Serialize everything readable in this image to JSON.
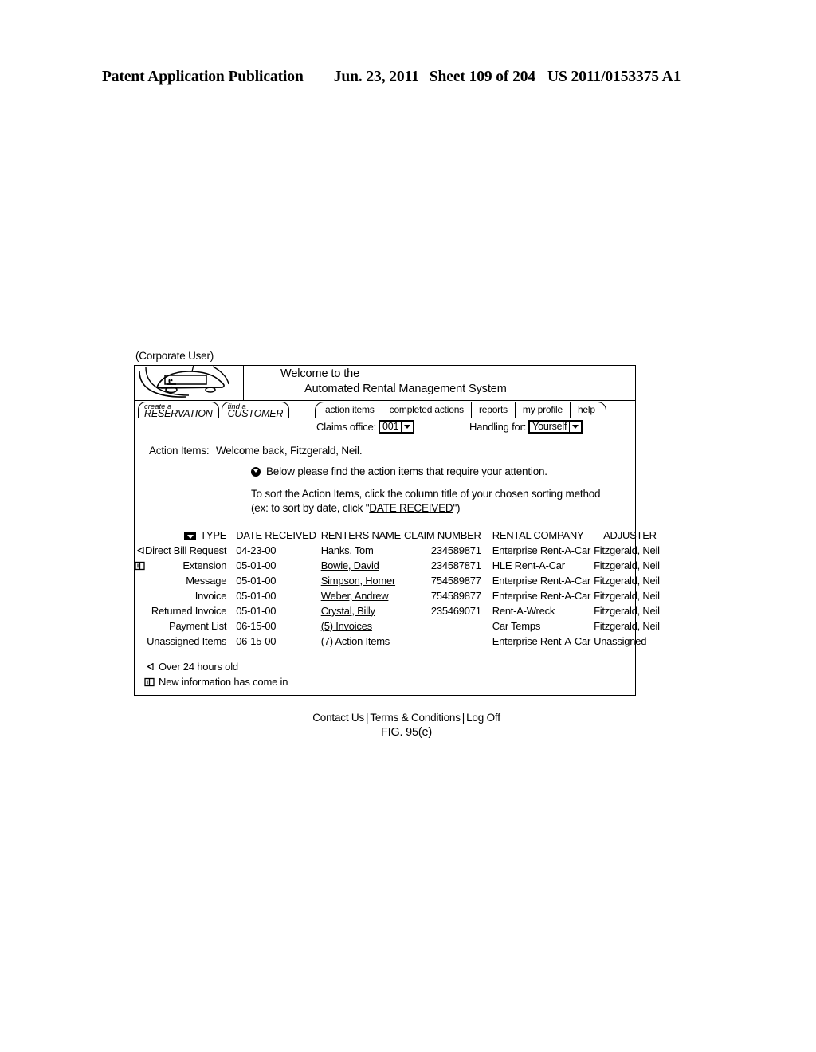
{
  "patent_header": {
    "publication": "Patent Application Publication",
    "date": "Jun. 23, 2011",
    "sheet": "Sheet 109 of 204",
    "number": "US 2011/0153375 A1"
  },
  "figure": {
    "user_role_label": "(Corporate User)",
    "caption": "FIG. 95(e)"
  },
  "banner": {
    "logo_icon": "car-with-e-badge-icon",
    "logo_badge": "e",
    "welcome_line1": "Welcome to the",
    "welcome_line2": "Automated Rental Management System"
  },
  "left_tabs": [
    {
      "small": "create a",
      "big": "RESERVATION"
    },
    {
      "small": "find a",
      "big": "CUSTOMER"
    }
  ],
  "nav_tabs": [
    {
      "label": "action items",
      "active": true
    },
    {
      "label": "completed actions",
      "active": false
    },
    {
      "label": "reports",
      "active": false
    },
    {
      "label": "my profile",
      "active": false
    },
    {
      "label": "help",
      "active": false
    }
  ],
  "controls": {
    "claims_office_label": "Claims office:",
    "claims_office_value": "001",
    "handling_for_label": "Handling for:",
    "handling_for_value": "Yourself"
  },
  "body": {
    "greeting_label": "Action Items:",
    "greeting_text": "Welcome back, Fitzgerald, Neil.",
    "bullet_icon": "circle-down-arrow-icon",
    "bullet_text": "Below please find the action items that require your attention.",
    "sort_line1": "To sort the Action Items, click the column title of your chosen sorting method",
    "sort_line2_pre": "(ex: to sort by date, click \"",
    "sort_line2_link": "DATE RECEIVED",
    "sort_line2_post": "\")"
  },
  "table": {
    "type_dropdown_icon": "type-filter-dropdown-icon",
    "columns": [
      "TYPE",
      "DATE RECEIVED",
      "RENTERS NAME",
      "CLAIM NUMBER",
      "RENTAL COMPANY",
      "ADJUSTER"
    ],
    "rows": [
      {
        "flag": "over-24-hours-icon",
        "type": "Direct Bill Request",
        "date_received": "04-23-00",
        "renters_name": "Hanks, Tom",
        "claim_number": "234589871",
        "rental_company": "Enterprise Rent-A-Car",
        "adjuster": "Fitzgerald, Neil"
      },
      {
        "flag": "new-information-icon",
        "type": "Extension",
        "date_received": "05-01-00",
        "renters_name": "Bowie, David",
        "claim_number": "234587871",
        "rental_company": "HLE Rent-A-Car",
        "adjuster": "Fitzgerald, Neil"
      },
      {
        "flag": "",
        "type": "Message",
        "date_received": "05-01-00",
        "renters_name": "Simpson, Homer",
        "claim_number": "754589877",
        "rental_company": "Enterprise Rent-A-Car",
        "adjuster": "Fitzgerald, Neil"
      },
      {
        "flag": "",
        "type": "Invoice",
        "date_received": "05-01-00",
        "renters_name": "Weber, Andrew",
        "claim_number": "754589877",
        "rental_company": "Enterprise Rent-A-Car",
        "adjuster": "Fitzgerald, Neil"
      },
      {
        "flag": "",
        "type": "Returned Invoice",
        "date_received": "05-01-00",
        "renters_name": "Crystal, Billy",
        "claim_number": "235469071",
        "rental_company": "Rent-A-Wreck",
        "adjuster": "Fitzgerald, Neil"
      },
      {
        "flag": "",
        "type": "Payment List",
        "date_received": "06-15-00",
        "renters_name": "(5) Invoices",
        "claim_number": "",
        "rental_company": "Car Temps",
        "adjuster": "Fitzgerald, Neil"
      },
      {
        "flag": "",
        "type": "Unassigned Items",
        "date_received": "06-15-00",
        "renters_name": "(7) Action Items",
        "claim_number": "",
        "rental_company": "Enterprise Rent-A-Car",
        "adjuster": "Unassigned"
      }
    ]
  },
  "legend": [
    {
      "icon": "over-24-hours-icon",
      "text": "Over 24 hours old"
    },
    {
      "icon": "new-information-icon",
      "text": "New information has come in"
    }
  ],
  "footer": {
    "links": [
      "Contact Us",
      "Terms & Conditions",
      "Log Off"
    ],
    "separator": "|"
  }
}
